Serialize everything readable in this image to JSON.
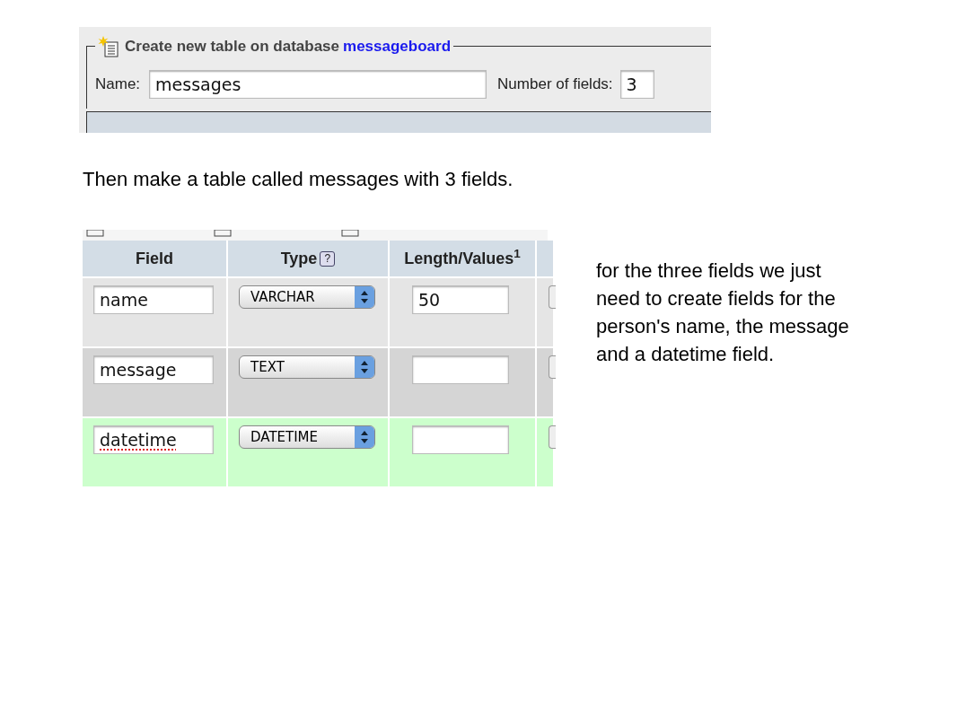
{
  "create_panel": {
    "legend": "Create new table on database",
    "database": "messageboard",
    "name_label": "Name:",
    "name_value": "messages",
    "fields_label": "Number of fields:",
    "fields_value": "3"
  },
  "caption": "Then make a table called messages with 3 fields.",
  "fields_table": {
    "columns": [
      {
        "label": "Field"
      },
      {
        "label": "Type",
        "help": "?"
      },
      {
        "label": "Length/Values$^{1}$"
      }
    ],
    "rows": [
      {
        "field": "name",
        "type": "VARCHAR",
        "length": "50",
        "highlighted": false,
        "misspelled": false
      },
      {
        "field": "message",
        "type": "TEXT",
        "highlighted": false,
        "misspelled": false
      },
      {
        "field": "datetime",
        "type": "DATETIME",
        "highlighted": true,
        "misspelled": true
      }
    ]
  },
  "note": "for the three fields we just need to create fields for the person's name, the message and a datetime field."
}
